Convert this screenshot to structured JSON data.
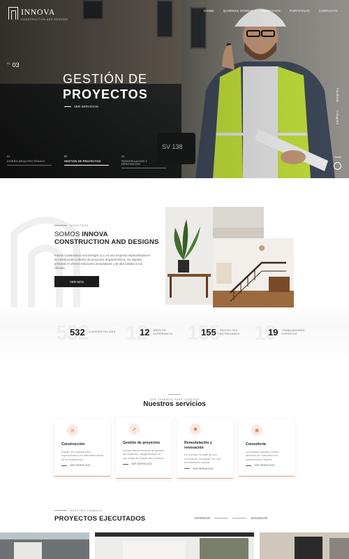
{
  "header": {
    "logo_name": "INNOVA",
    "logo_sub": "CONSTRUCTION AND DESIGNS",
    "nav": [
      "HOME",
      "QUIÉNES SOMOS",
      "SERVICIOS",
      "PORTFOLIO",
      "CONTACTO"
    ]
  },
  "hero": {
    "slide_current": "03",
    "slide_prefix": "01",
    "title_line1": "GESTIÓN DE",
    "title_line2": "PROYECTOS",
    "link": "VER SERVICIOS",
    "social_1": "Facebook",
    "social_2": "Instagram",
    "scroll": "Scroll",
    "slides": [
      {
        "n": "01",
        "label": "DISEÑO ARQUITECTÓNICO",
        "active": false
      },
      {
        "n": "02",
        "label": "GESTIÓN DE PROYECTOS",
        "active": true
      },
      {
        "n": "03",
        "label": "REMODELACIÓN Y RENOVACIÓN",
        "active": false
      }
    ]
  },
  "about": {
    "eyebrow": "NOSOTROS",
    "title_a": "SOMOS ",
    "title_b": "INNOVA",
    "title_c": "CONSTRUCTION AND DESIGNS",
    "text": "Innova Construction And Designs LLC es una empresa especializada en la construcción y diseño de proyectos arquitectónicos. Su objetivo principal es ofrecer soluciones innovadoras y de alta calidad a sus clientes.",
    "button": "VER MÁS"
  },
  "stats": [
    {
      "value": "532",
      "label": "CLIENTES FELICES"
    },
    {
      "value": "12",
      "label": "AÑOS DE EXPERIENCIA"
    },
    {
      "value": "155",
      "label": "PROYECTOS ENTREGADOS"
    },
    {
      "value": "19",
      "label": "TRABAJADORES EXPERTOS"
    }
  ],
  "services": {
    "eyebrow": "QUÉ TENEMOS PARA OFRECER",
    "title": "Nuestros servicios",
    "items": [
      {
        "title": "Construcción",
        "text": "Equipo de profesionales especializados en diferentes áreas de la construcción.",
        "more": "VER SERVICIOS"
      },
      {
        "title": "Gestión de proyectos",
        "text": "Innova ofrece servicios de gestión de proyectos, asegurándose de que todas las etapas del proyecto.",
        "more": "VER SERVICIOS"
      },
      {
        "title": "Remodelación y renovación",
        "text": "Es una que se trate de una renovación completa o de una remodelación parcial.",
        "more": "VER SERVICIOS"
      },
      {
        "title": "Consultoría",
        "text": "La empresa también brinda servicios de consultoría en construcción y diseño.",
        "more": "VER SERVICIOS"
      }
    ]
  },
  "projects": {
    "eyebrow": "NUESTRO TRABAJO",
    "title": "PROYECTOS EJECUTADOS",
    "prev": "ANTERIOR",
    "next": "SIGUIENTE"
  },
  "colors": {
    "accent": "#e3a27a",
    "dark": "#1c1c1c",
    "vest": "#c6e33b"
  }
}
